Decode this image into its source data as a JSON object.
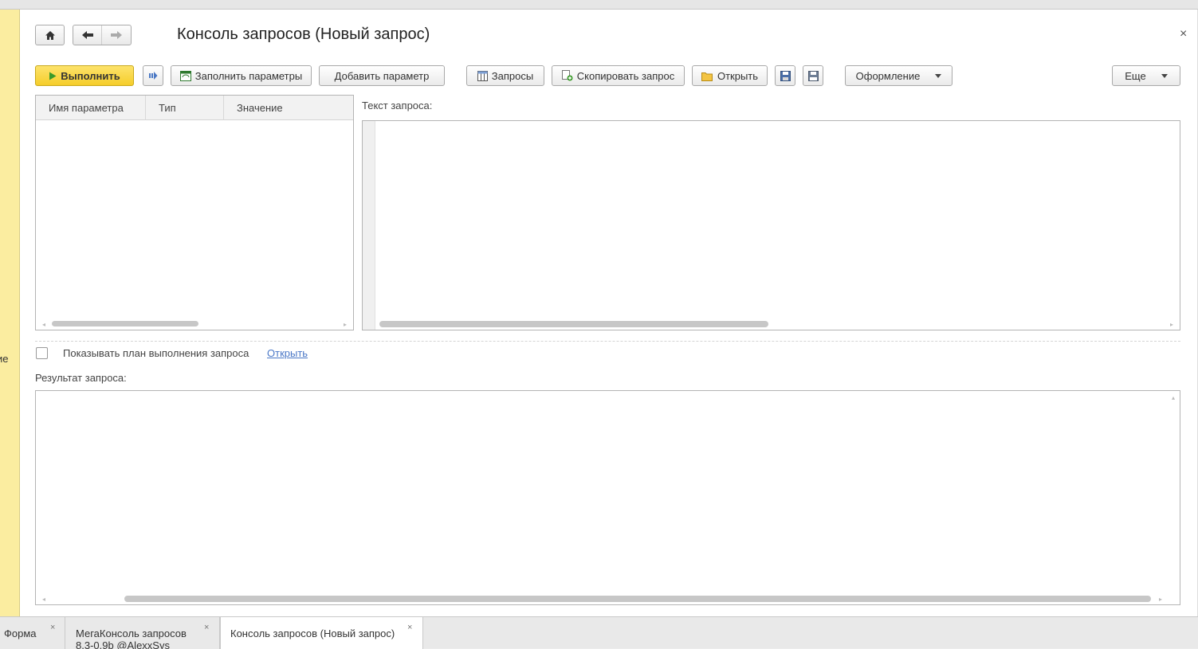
{
  "window": {
    "title": "Консоль запросов (Новый запрос)"
  },
  "left_panel": {
    "fragment": "ие"
  },
  "toolbar": {
    "run_label": "Выполнить",
    "fill_params_label": "Заполнить параметры",
    "add_param_label": "Добавить параметр",
    "queries_label": "Запросы",
    "copy_query_label": "Скопировать запрос",
    "open_label": "Открыть",
    "design_label": "Оформление",
    "more_label": "Еще"
  },
  "params_table": {
    "columns": [
      "Имя параметра",
      "Тип",
      "Значение"
    ]
  },
  "query_text": {
    "label": "Текст запроса:"
  },
  "plan": {
    "checkbox_label": "Показывать план выполнения запроса",
    "checked": false,
    "link_label": "Открыть"
  },
  "result": {
    "label": "Результат запроса:"
  },
  "tabs": [
    {
      "label": "Форма",
      "active": false
    },
    {
      "label": "МегаКонсоль запросов",
      "label2": "8.3-0.9b @AlexxSys",
      "active": false
    },
    {
      "label": "Консоль запросов (Новый запрос)",
      "active": true
    }
  ],
  "colors": {
    "primary_button": "#f5cd2a",
    "left_panel": "#fbeda0",
    "link": "#4b78c7"
  }
}
